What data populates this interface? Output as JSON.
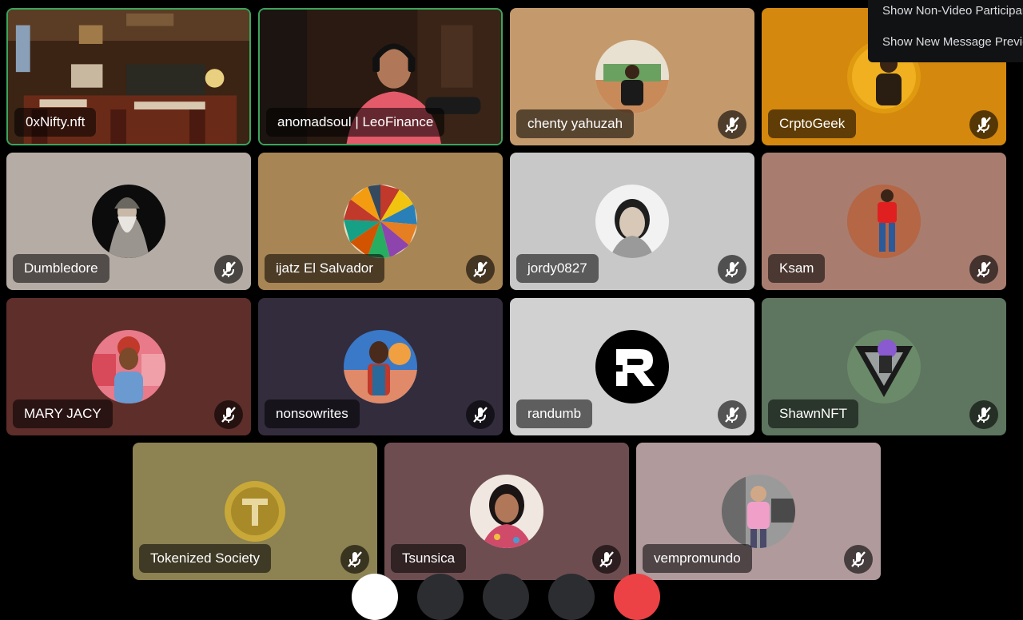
{
  "menu": {
    "items": [
      {
        "label": "Show Non-Video Participants"
      },
      {
        "label": "Show New Message Previews"
      }
    ]
  },
  "participants": [
    {
      "name": "0xNifty.nft",
      "type": "video",
      "scene": "restaurant"
    },
    {
      "name": "anomadsoul | LeoFinance",
      "type": "video",
      "scene": "streamer"
    },
    {
      "name": "chenty yahuzah",
      "type": "avatar",
      "color": "#c49a6c",
      "muted": true
    },
    {
      "name": "CrptoGeek",
      "type": "avatar",
      "color": "#d4880e",
      "muted": true
    },
    {
      "name": "Dumbledore",
      "type": "avatar",
      "color": "#b5aca5",
      "muted": true
    },
    {
      "name": "ijatz El Salvador",
      "type": "avatar",
      "color": "#a88555",
      "muted": true
    },
    {
      "name": "jordy0827",
      "type": "avatar",
      "color": "#c8c8c8",
      "muted": true
    },
    {
      "name": "Ksam",
      "type": "avatar",
      "color": "#a87d70",
      "muted": true
    },
    {
      "name": "MARY JACY",
      "type": "avatar",
      "color": "#5e2e2a",
      "muted": true
    },
    {
      "name": "nonsowrites",
      "type": "avatar",
      "color": "#322c3c",
      "muted": true
    },
    {
      "name": "randumb",
      "type": "avatar",
      "color": "#d1d1d1",
      "muted": true
    },
    {
      "name": "ShawnNFT",
      "type": "avatar",
      "color": "#5e7560",
      "muted": true
    },
    {
      "name": "Tokenized Society",
      "type": "avatar",
      "color": "#8c8252",
      "muted": true
    },
    {
      "name": "Tsunsica",
      "type": "avatar",
      "color": "#6e4d50",
      "muted": true
    },
    {
      "name": "vempromundo",
      "type": "avatar",
      "color": "#b09a9b",
      "muted": true
    }
  ],
  "controls": [
    {
      "icon": "camera-icon",
      "color": "#ffffff"
    },
    {
      "icon": "microphone-icon",
      "color": "#2b2d31"
    },
    {
      "icon": "screen-share-icon",
      "color": "#2b2d31"
    },
    {
      "icon": "activity-icon",
      "color": "#2b2d31"
    },
    {
      "icon": "disconnect-icon",
      "color": "#ed4245"
    }
  ]
}
